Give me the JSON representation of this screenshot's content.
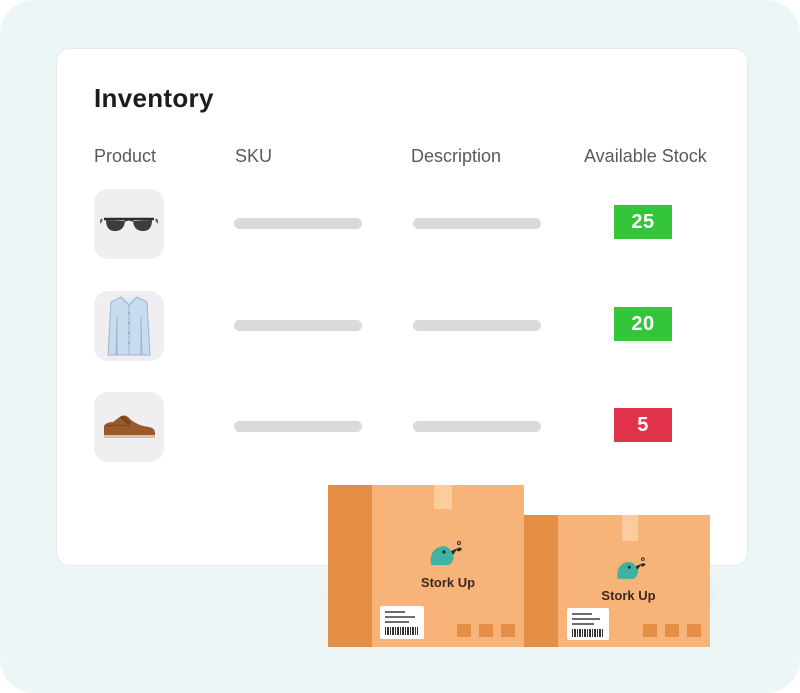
{
  "inventory": {
    "title": "Inventory",
    "columns": {
      "product": "Product",
      "sku": "SKU",
      "description": "Description",
      "stock": "Available Stock"
    },
    "rows": [
      {
        "product_icon": "sunglasses-icon",
        "stock": "25",
        "status_color": "#34c638"
      },
      {
        "product_icon": "shirt-icon",
        "stock": "20",
        "status_color": "#34c638"
      },
      {
        "product_icon": "shoe-icon",
        "stock": "5",
        "status_color": "#e0324b"
      }
    ]
  },
  "boxes": [
    {
      "brand": "Stork Up",
      "logo_icon": "stork-bird-icon"
    },
    {
      "brand": "Stork Up",
      "logo_icon": "stork-bird-icon"
    }
  ],
  "colors": {
    "background": "#edf6f7",
    "box_front": "#f8b378",
    "box_side": "#e58e45",
    "bird": "#3fb2a4"
  }
}
